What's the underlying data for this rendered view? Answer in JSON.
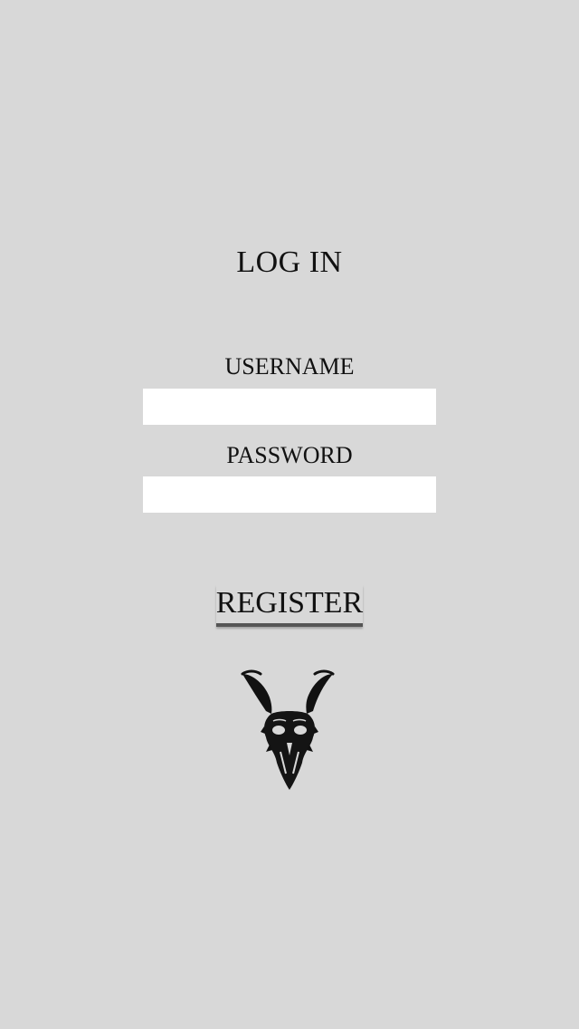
{
  "login": {
    "title": "LOG IN",
    "username_label": "USERNAME",
    "username_value": "",
    "password_label": "PASSWORD",
    "password_value": "",
    "register_label": "REGISTER"
  },
  "logo": {
    "icon": "goat-skull-icon"
  },
  "colors": {
    "background": "#d8d8d8",
    "input_background": "#ffffff",
    "text": "#111111",
    "underline": "#555555"
  }
}
